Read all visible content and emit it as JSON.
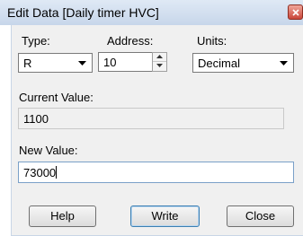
{
  "window": {
    "title": "Edit Data [Daily timer HVC]"
  },
  "form": {
    "type_label": "Type:",
    "type_value": "R",
    "address_label": "Address:",
    "address_value": "10",
    "units_label": "Units:",
    "units_value": "Decimal",
    "current_value_label": "Current Value:",
    "current_value": "1100",
    "new_value_label": "New Value:",
    "new_value": "73000"
  },
  "buttons": {
    "help": "Help",
    "write": "Write",
    "close": "Close"
  },
  "icons": {
    "close": "close-icon",
    "dropdown": "chevron-down-icon",
    "spin_up": "arrow-up-icon",
    "spin_down": "arrow-down-icon"
  }
}
